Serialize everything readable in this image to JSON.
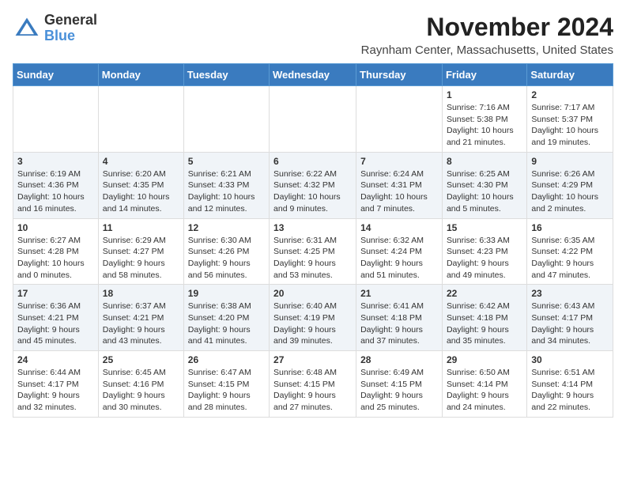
{
  "header": {
    "logo": {
      "general": "General",
      "blue": "Blue"
    },
    "title": "November 2024",
    "location": "Raynham Center, Massachusetts, United States"
  },
  "weekdays": [
    "Sunday",
    "Monday",
    "Tuesday",
    "Wednesday",
    "Thursday",
    "Friday",
    "Saturday"
  ],
  "weeks": [
    [
      {
        "day": "",
        "info": ""
      },
      {
        "day": "",
        "info": ""
      },
      {
        "day": "",
        "info": ""
      },
      {
        "day": "",
        "info": ""
      },
      {
        "day": "",
        "info": ""
      },
      {
        "day": "1",
        "info": "Sunrise: 7:16 AM\nSunset: 5:38 PM\nDaylight: 10 hours and 21 minutes."
      },
      {
        "day": "2",
        "info": "Sunrise: 7:17 AM\nSunset: 5:37 PM\nDaylight: 10 hours and 19 minutes."
      }
    ],
    [
      {
        "day": "3",
        "info": "Sunrise: 6:19 AM\nSunset: 4:36 PM\nDaylight: 10 hours and 16 minutes."
      },
      {
        "day": "4",
        "info": "Sunrise: 6:20 AM\nSunset: 4:35 PM\nDaylight: 10 hours and 14 minutes."
      },
      {
        "day": "5",
        "info": "Sunrise: 6:21 AM\nSunset: 4:33 PM\nDaylight: 10 hours and 12 minutes."
      },
      {
        "day": "6",
        "info": "Sunrise: 6:22 AM\nSunset: 4:32 PM\nDaylight: 10 hours and 9 minutes."
      },
      {
        "day": "7",
        "info": "Sunrise: 6:24 AM\nSunset: 4:31 PM\nDaylight: 10 hours and 7 minutes."
      },
      {
        "day": "8",
        "info": "Sunrise: 6:25 AM\nSunset: 4:30 PM\nDaylight: 10 hours and 5 minutes."
      },
      {
        "day": "9",
        "info": "Sunrise: 6:26 AM\nSunset: 4:29 PM\nDaylight: 10 hours and 2 minutes."
      }
    ],
    [
      {
        "day": "10",
        "info": "Sunrise: 6:27 AM\nSunset: 4:28 PM\nDaylight: 10 hours and 0 minutes."
      },
      {
        "day": "11",
        "info": "Sunrise: 6:29 AM\nSunset: 4:27 PM\nDaylight: 9 hours and 58 minutes."
      },
      {
        "day": "12",
        "info": "Sunrise: 6:30 AM\nSunset: 4:26 PM\nDaylight: 9 hours and 56 minutes."
      },
      {
        "day": "13",
        "info": "Sunrise: 6:31 AM\nSunset: 4:25 PM\nDaylight: 9 hours and 53 minutes."
      },
      {
        "day": "14",
        "info": "Sunrise: 6:32 AM\nSunset: 4:24 PM\nDaylight: 9 hours and 51 minutes."
      },
      {
        "day": "15",
        "info": "Sunrise: 6:33 AM\nSunset: 4:23 PM\nDaylight: 9 hours and 49 minutes."
      },
      {
        "day": "16",
        "info": "Sunrise: 6:35 AM\nSunset: 4:22 PM\nDaylight: 9 hours and 47 minutes."
      }
    ],
    [
      {
        "day": "17",
        "info": "Sunrise: 6:36 AM\nSunset: 4:21 PM\nDaylight: 9 hours and 45 minutes."
      },
      {
        "day": "18",
        "info": "Sunrise: 6:37 AM\nSunset: 4:21 PM\nDaylight: 9 hours and 43 minutes."
      },
      {
        "day": "19",
        "info": "Sunrise: 6:38 AM\nSunset: 4:20 PM\nDaylight: 9 hours and 41 minutes."
      },
      {
        "day": "20",
        "info": "Sunrise: 6:40 AM\nSunset: 4:19 PM\nDaylight: 9 hours and 39 minutes."
      },
      {
        "day": "21",
        "info": "Sunrise: 6:41 AM\nSunset: 4:18 PM\nDaylight: 9 hours and 37 minutes."
      },
      {
        "day": "22",
        "info": "Sunrise: 6:42 AM\nSunset: 4:18 PM\nDaylight: 9 hours and 35 minutes."
      },
      {
        "day": "23",
        "info": "Sunrise: 6:43 AM\nSunset: 4:17 PM\nDaylight: 9 hours and 34 minutes."
      }
    ],
    [
      {
        "day": "24",
        "info": "Sunrise: 6:44 AM\nSunset: 4:17 PM\nDaylight: 9 hours and 32 minutes."
      },
      {
        "day": "25",
        "info": "Sunrise: 6:45 AM\nSunset: 4:16 PM\nDaylight: 9 hours and 30 minutes."
      },
      {
        "day": "26",
        "info": "Sunrise: 6:47 AM\nSunset: 4:15 PM\nDaylight: 9 hours and 28 minutes."
      },
      {
        "day": "27",
        "info": "Sunrise: 6:48 AM\nSunset: 4:15 PM\nDaylight: 9 hours and 27 minutes."
      },
      {
        "day": "28",
        "info": "Sunrise: 6:49 AM\nSunset: 4:15 PM\nDaylight: 9 hours and 25 minutes."
      },
      {
        "day": "29",
        "info": "Sunrise: 6:50 AM\nSunset: 4:14 PM\nDaylight: 9 hours and 24 minutes."
      },
      {
        "day": "30",
        "info": "Sunrise: 6:51 AM\nSunset: 4:14 PM\nDaylight: 9 hours and 22 minutes."
      }
    ]
  ]
}
